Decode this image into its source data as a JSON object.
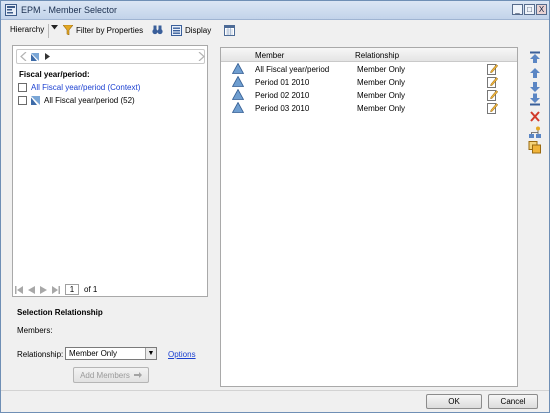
{
  "window": {
    "title": "EPM - Member Selector",
    "controls": [
      "_",
      "□",
      "X"
    ]
  },
  "toolbar": {
    "hierarchy_label": "Hierarchy",
    "filter_label": "Filter by Properties",
    "display_label": "Display"
  },
  "left": {
    "dimension_label": "Fiscal year/period:",
    "items": [
      {
        "label": "All Fiscal year/period (Context)",
        "checked": false,
        "link": true
      },
      {
        "label": "All Fiscal year/period (52)",
        "checked": false,
        "link": false
      }
    ],
    "pager": {
      "page": "1",
      "of_text": "of 1"
    }
  },
  "selection": {
    "title": "Selection Relationship",
    "members_label": "Members:",
    "relationship_label": "Relationship:",
    "relationship_value": "Member Only",
    "options_link": "Options",
    "add_members_label": "Add Members"
  },
  "grid": {
    "col_member": "Member",
    "col_relationship": "Relationship",
    "rows": [
      {
        "member": "All Fiscal year/period",
        "relationship": "Member Only"
      },
      {
        "member": "Period 01 2010",
        "relationship": "Member Only"
      },
      {
        "member": "Period 02 2010",
        "relationship": "Member Only"
      },
      {
        "member": "Period 03 2010",
        "relationship": "Member Only"
      }
    ]
  },
  "footer": {
    "ok_label": "OK",
    "cancel_label": "Cancel"
  },
  "colors": {
    "link": "#1a3fd1",
    "triangle_fill": "#6f9ed0",
    "remove_icon": "#d23a2a"
  }
}
